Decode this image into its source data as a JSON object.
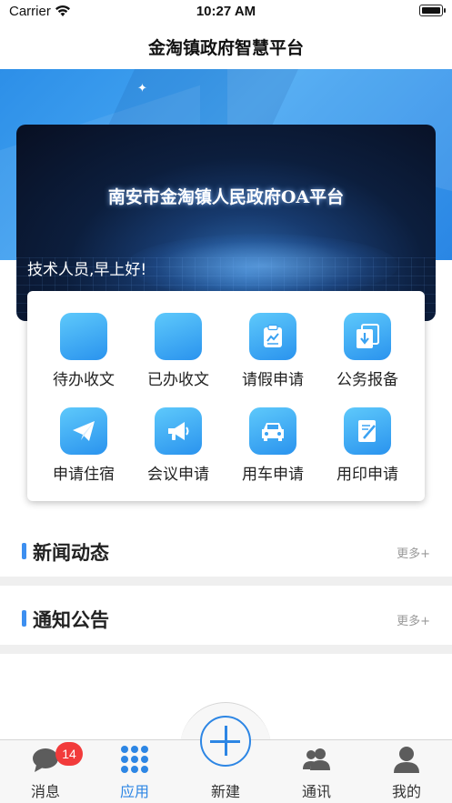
{
  "status_bar": {
    "carrier": "Carrier",
    "time": "10:27 AM"
  },
  "nav": {
    "title": "金淘镇政府智慧平台"
  },
  "banner": {
    "title": "南安市金淘镇人民政府OA平台",
    "greeting": "技术人员,早上好!"
  },
  "apps": [
    {
      "label": "待办收文",
      "icon": "blank-app-icon"
    },
    {
      "label": "已办收文",
      "icon": "blank-app-icon"
    },
    {
      "label": "请假申请",
      "icon": "clipboard-chart-icon"
    },
    {
      "label": "公务报备",
      "icon": "download-document-icon"
    },
    {
      "label": "申请住宿",
      "icon": "paper-plane-icon"
    },
    {
      "label": "会议申请",
      "icon": "megaphone-icon"
    },
    {
      "label": "用车申请",
      "icon": "car-icon"
    },
    {
      "label": "用印申请",
      "icon": "notebook-pen-icon"
    }
  ],
  "sections": {
    "news": {
      "title": "新闻动态",
      "more": "更多+"
    },
    "notice": {
      "title": "通知公告",
      "more": "更多+"
    }
  },
  "tabs": [
    {
      "label": "消息",
      "icon": "chat-bubble-icon",
      "badge": "14"
    },
    {
      "label": "应用",
      "icon": "grid-dots-icon",
      "active": true
    },
    {
      "label": "新建",
      "icon": "plus-circle-icon"
    },
    {
      "label": "通讯",
      "icon": "contacts-icon"
    },
    {
      "label": "我的",
      "icon": "person-icon"
    }
  ],
  "colors": {
    "accent": "#2d86e4",
    "badge": "#f23b3b",
    "icon_gradient_start": "#5ec9fb",
    "icon_gradient_end": "#2a93ee"
  }
}
